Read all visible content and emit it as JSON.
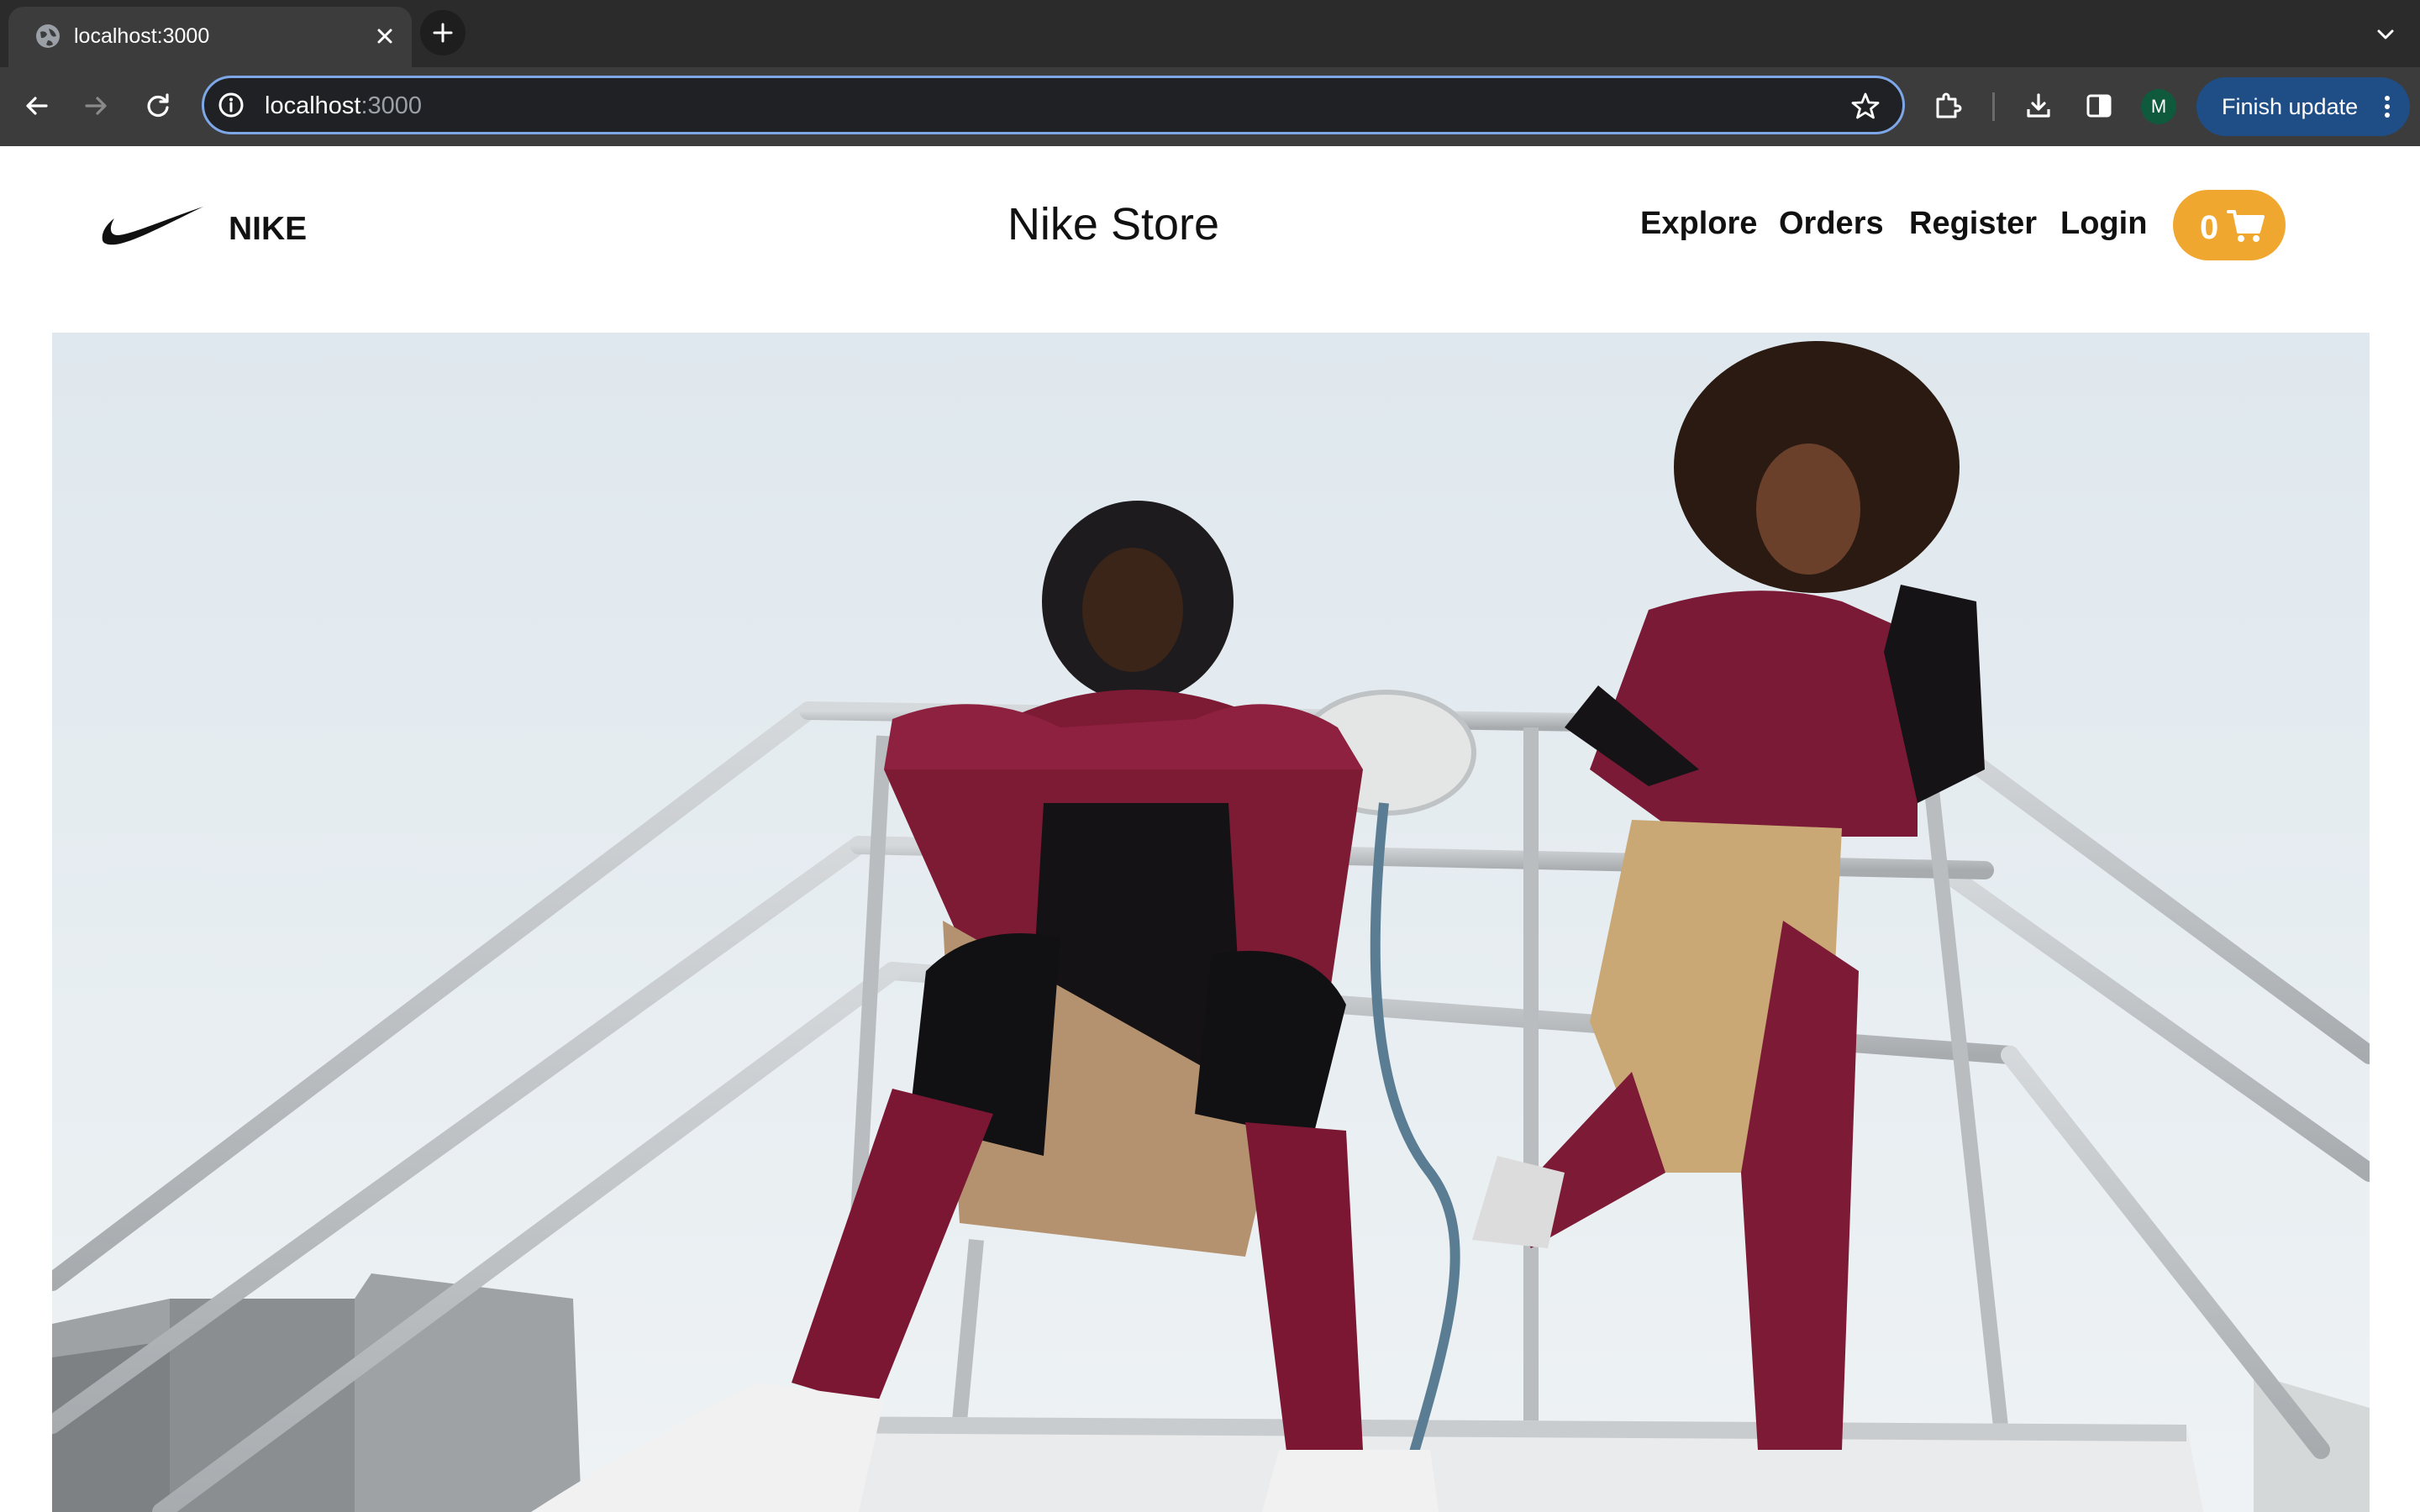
{
  "browser": {
    "tab": {
      "title": "localhost:3000"
    },
    "address_bar": {
      "host": "localhost",
      "port": ":3000"
    },
    "profile": {
      "initial": "M"
    },
    "update_button": {
      "label": "Finish update"
    }
  },
  "header": {
    "brand": "NIKE",
    "title": "Nike Store",
    "nav": [
      {
        "label": "Explore"
      },
      {
        "label": "Orders"
      },
      {
        "label": "Register"
      },
      {
        "label": "Login"
      }
    ],
    "cart": {
      "count": "0",
      "icon": "shopping-cart-icon",
      "color": "#f0a72f"
    }
  },
  "hero": {
    "image": "hero-photo",
    "alt_description_visible": false
  },
  "colors": {
    "accent": "#f0a72f",
    "chrome_dark": "#2b2b2b",
    "chrome_toolbar": "#3c3c3c",
    "omnibox_focus": "#7ea7e8",
    "update_button": "#1f4e86"
  }
}
